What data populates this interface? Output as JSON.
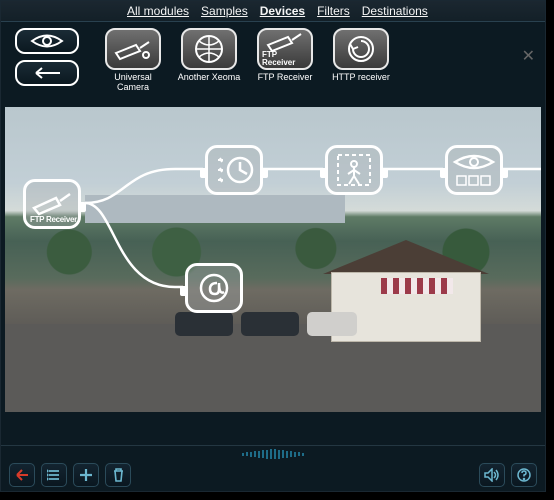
{
  "tabs": {
    "all_modules": "All modules",
    "samples": "Samples",
    "devices": "Devices",
    "filters": "Filters",
    "destinations": "Destinations"
  },
  "leftControls": {
    "eye": "eye-toggle",
    "back": "back-arrow"
  },
  "modules": [
    {
      "id": "universal-camera",
      "label": "Universal\nCamera",
      "icon": "camera"
    },
    {
      "id": "another-xeoma",
      "label": "Another Xeoma",
      "icon": "globe"
    },
    {
      "id": "ftp-receiver",
      "label": "FTP Receiver",
      "icon": "camera",
      "badge": "FTP\nReceiver"
    },
    {
      "id": "http-receiver",
      "label": "HTTP receiver",
      "icon": "http"
    }
  ],
  "flow_modules": {
    "ftp": {
      "label": "FTP\nReceiver"
    },
    "scheduler": {
      "label": ""
    },
    "motion": {
      "label": ""
    },
    "preview": {
      "label": ""
    },
    "email": {
      "label": ""
    }
  },
  "bottombar": {
    "left": "◄",
    "list": "list",
    "add": "+",
    "trash": "trash",
    "vol": "volume",
    "help": "?"
  }
}
